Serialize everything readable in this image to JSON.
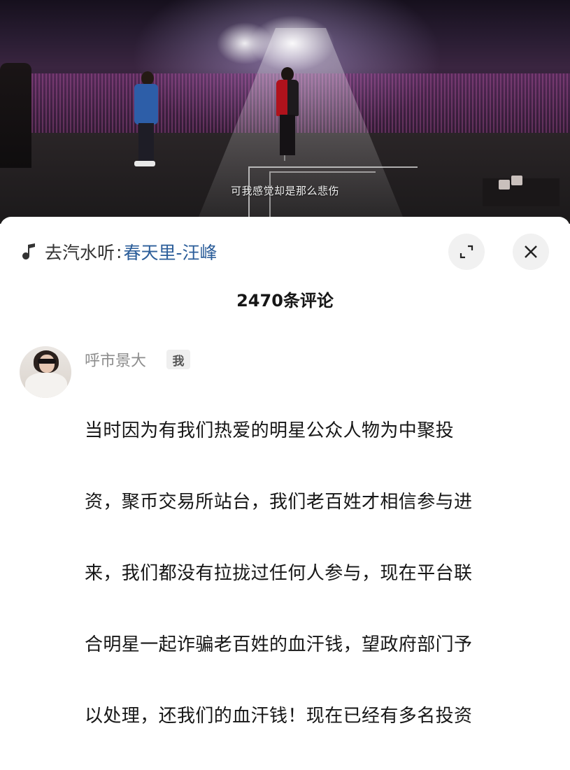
{
  "video": {
    "subtitle": "可我感觉却是那么悲伤"
  },
  "music_bar": {
    "icon": "music-note-icon",
    "prefix": "去汽水听",
    "separator": ":",
    "song": "春天里-汪峰",
    "song_color": "#2c5e9a",
    "expand_icon": "expand-icon",
    "close_icon": "close-icon"
  },
  "comments_header": {
    "count_label": "2470条评论"
  },
  "comment": {
    "username": "呼市景大",
    "badge": "我",
    "lines": [
      "当时因为有我们热爱的明星公众人物为中聚投",
      "资，聚币交易所站台，我们老百姓才相信参与进",
      "来，我们都没有拉拢过任何人参与，现在平台联",
      "合明星一起诈骗老百姓的血汗钱，望政府部门予",
      "以处理，还我们的血汗钱！现在已经有多名投资"
    ]
  }
}
